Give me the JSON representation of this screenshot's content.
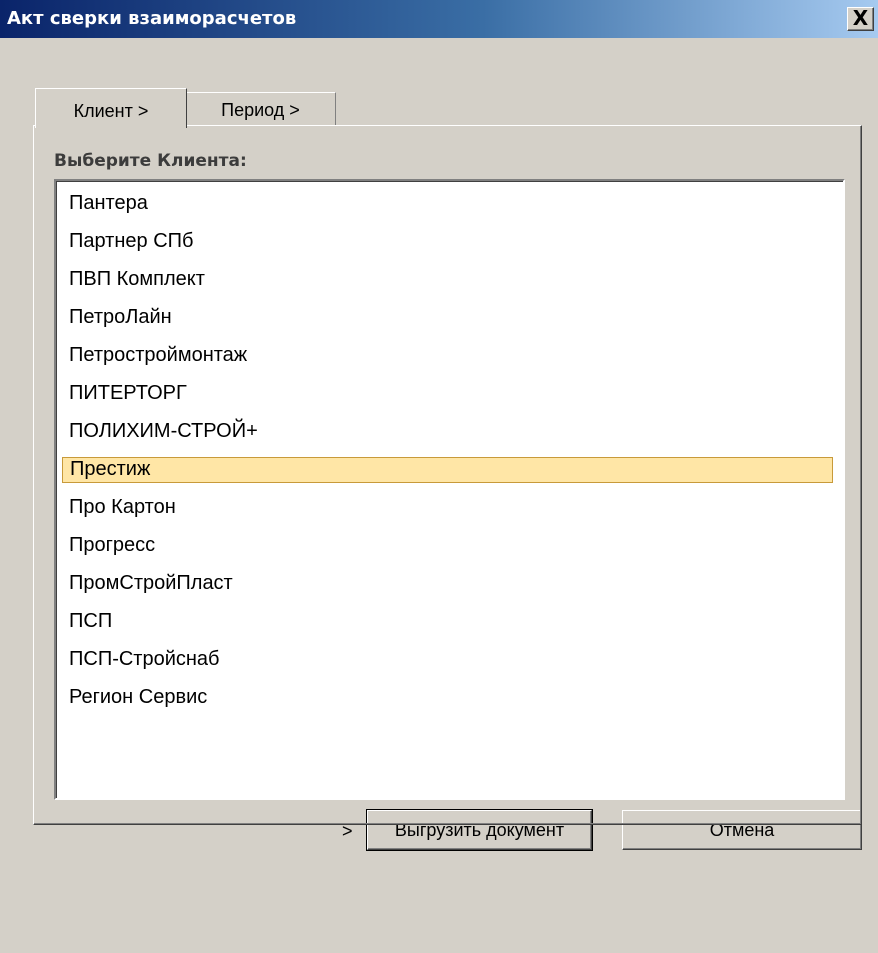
{
  "window": {
    "title": "Акт сверки взаиморасчетов",
    "close_glyph": "X"
  },
  "tabs": [
    {
      "label": "Клиент >",
      "selected": true
    },
    {
      "label": "Период >",
      "selected": false
    }
  ],
  "client_panel": {
    "label": "Выберите Клиента:",
    "selected_index": 7,
    "clients": [
      "Пантера",
      "Партнер СПб",
      "ПВП Комплект",
      "ПетроЛайн",
      "Петростроймонтаж",
      "ПИТЕРТОРГ",
      "ПОЛИХИМ-СТРОЙ+",
      "Престиж",
      "Про Картон",
      "Прогресс",
      "ПромСтройПласт",
      "ПСП",
      "ПСП-Стройснаб",
      "Регион Сервис"
    ]
  },
  "footer": {
    "arrow": ">",
    "export_label": "Выгрузить документ",
    "cancel_label": "Отмена"
  },
  "colors": {
    "window_bg": "#d4d0c8",
    "title_bar_start": "#0a246a",
    "title_bar_end": "#a6caf0",
    "selection_bg": "#ffe6a6",
    "selection_border": "#c89a3a"
  }
}
